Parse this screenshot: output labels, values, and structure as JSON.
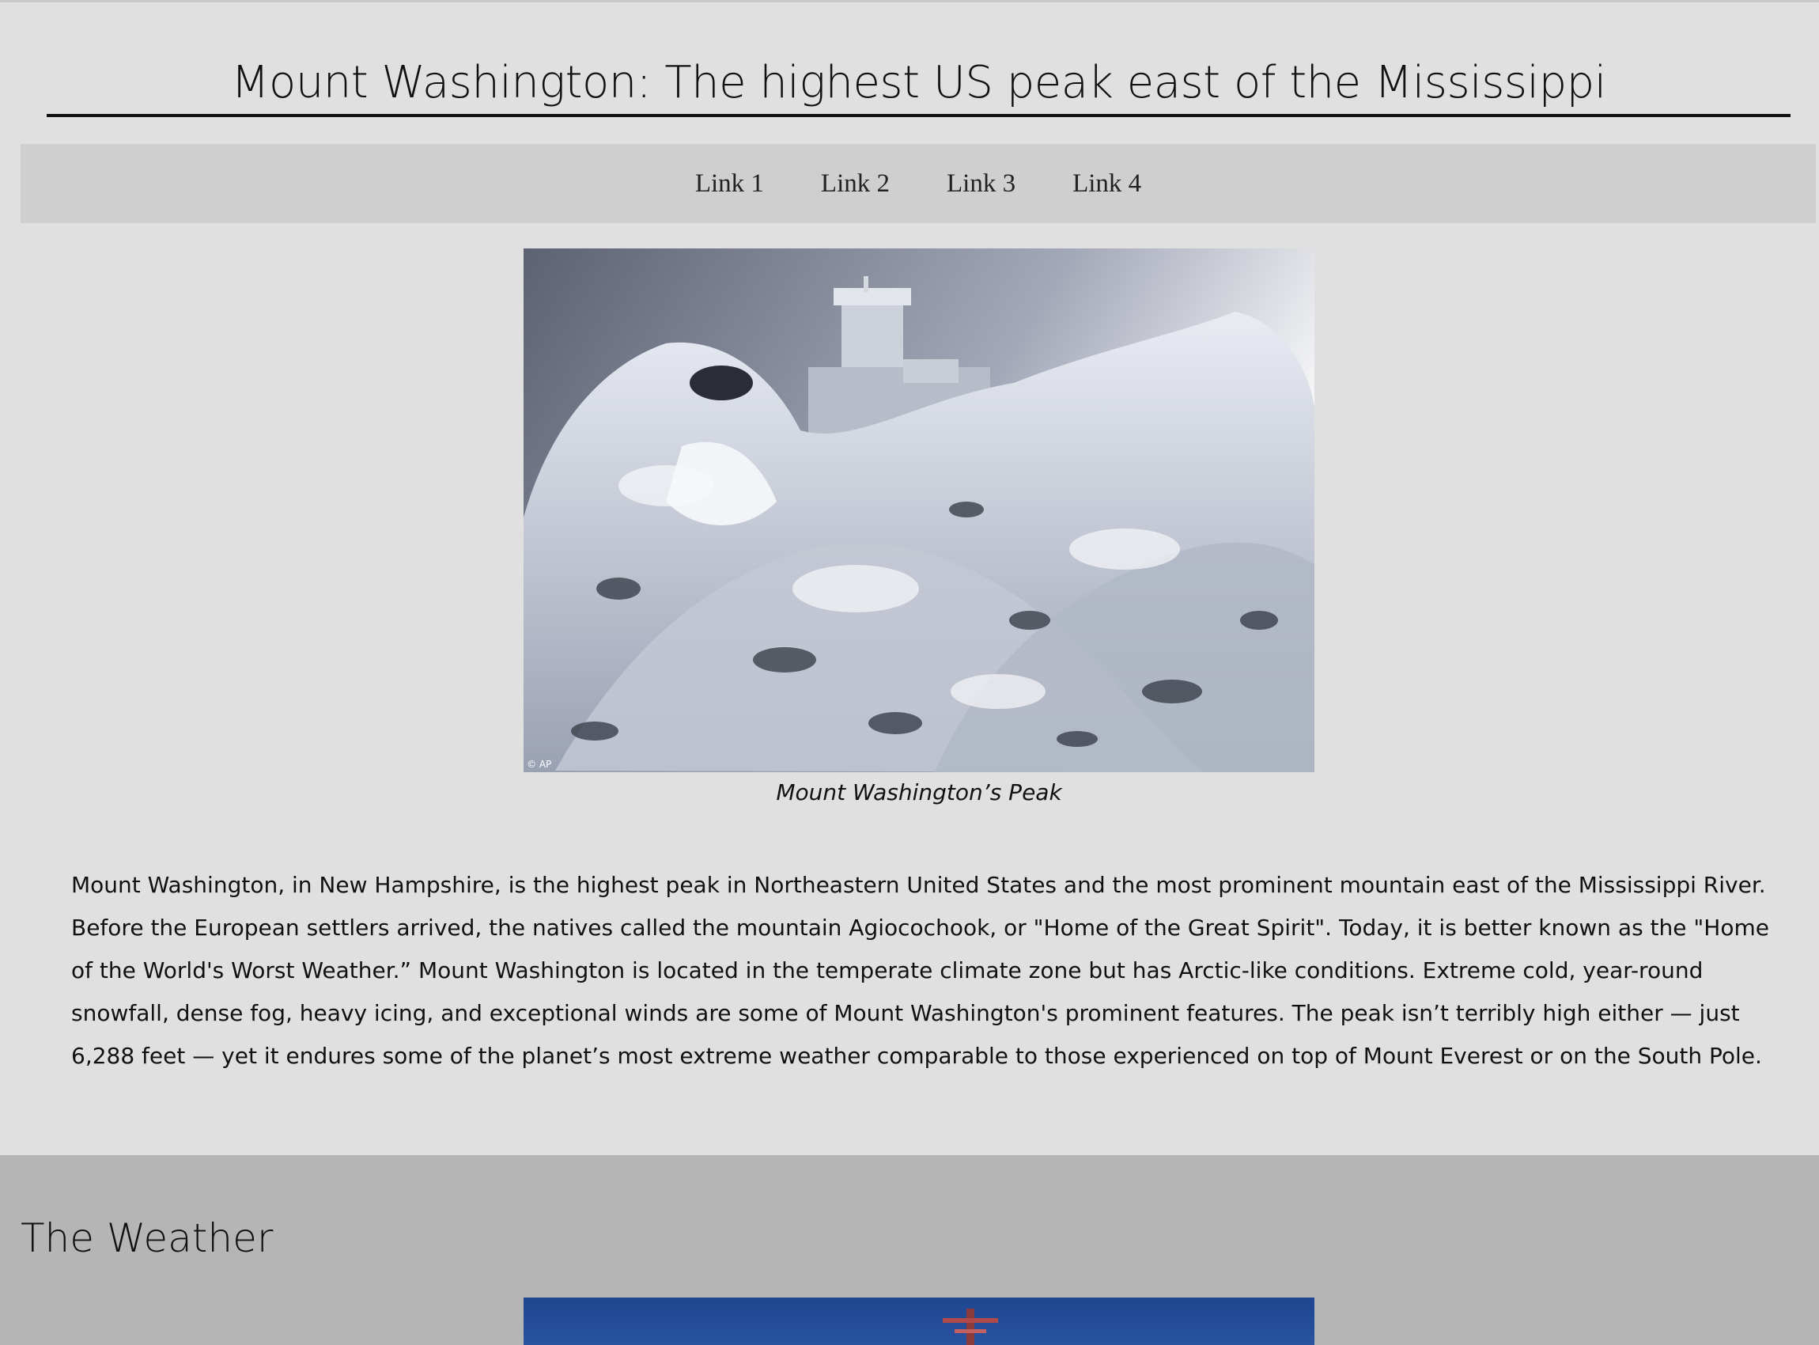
{
  "header": {
    "title": "Mount Washington: The highest US peak east of the Mississippi"
  },
  "nav": {
    "links": [
      {
        "label": "Link 1"
      },
      {
        "label": "Link 2"
      },
      {
        "label": "Link 3"
      },
      {
        "label": "Link 4"
      }
    ]
  },
  "figure": {
    "caption": "Mount Washington’s Peak",
    "photo_credit": "© AP"
  },
  "intro": {
    "text": "Mount Washington, in New Hampshire, is the highest peak in Northeastern United States and the most prominent mountain east of the Mississippi River. Before the European settlers arrived, the natives called the mountain Agiocochook, or \"Home of the Great Spirit\". Today, it is better known as the \"Home of the World's Worst Weather.” Mount Washington is located in the temperate climate zone but has Arctic-like conditions. Extreme cold, year-round snowfall, dense fog, heavy icing, and exceptional winds are some of Mount Washington's prominent features. The peak isn’t terribly high either — just 6,288 feet — yet it endures some of the planet’s most extreme weather comparable to those experienced on top of Mount Everest or on the South Pole."
  },
  "weather": {
    "heading": "The Weather"
  },
  "colors": {
    "page_background": "#e0e0e0",
    "nav_background": "#cfcfcf",
    "weather_section_background": "#b5b5b5",
    "sky_blue": "#1f4690"
  }
}
